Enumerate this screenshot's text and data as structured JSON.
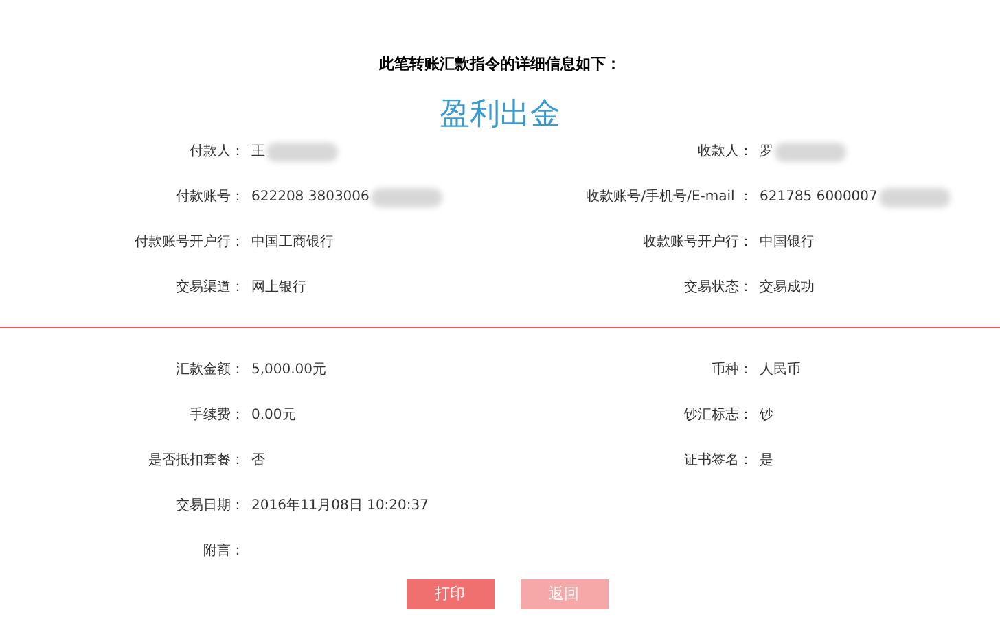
{
  "heading": "此笔转账汇款指令的详细信息如下：",
  "title": "盈利出金",
  "sections": [
    {
      "rows": [
        {
          "left": {
            "label": "付款人：",
            "value": "王",
            "redacted": true
          },
          "right": {
            "label": "收款人：",
            "value": "罗",
            "redacted": true
          }
        },
        {
          "left": {
            "label": "付款账号：",
            "value": "622208 3803006",
            "redacted": true
          },
          "right": {
            "label": "收款账号/手机号/E-mail ：",
            "value": "621785 6000007",
            "redacted": true
          }
        },
        {
          "left": {
            "label": "付款账号开户行：",
            "value": "中国工商银行"
          },
          "right": {
            "label": "收款账号开户行：",
            "value": "中国银行"
          }
        },
        {
          "left": {
            "label": "交易渠道：",
            "value": "网上银行"
          },
          "right": {
            "label": "交易状态：",
            "value": "交易成功"
          }
        }
      ]
    },
    {
      "rows": [
        {
          "left": {
            "label": "汇款金额：",
            "value": "5,000.00元"
          },
          "right": {
            "label": "币种：",
            "value": "人民币"
          }
        },
        {
          "left": {
            "label": "手续费：",
            "value": "0.00元"
          },
          "right": {
            "label": "钞汇标志：",
            "value": "钞"
          }
        },
        {
          "left": {
            "label": "是否抵扣套餐：",
            "value": "否"
          },
          "right": {
            "label": "证书签名：",
            "value": "是"
          }
        },
        {
          "left": {
            "label": "交易日期：",
            "value": "2016年11月08日 10:20:37"
          }
        },
        {
          "left": {
            "label": "附言："
          }
        }
      ]
    }
  ],
  "buttons": [
    {
      "label": "打印",
      "kind": "primary"
    },
    {
      "label": "返回",
      "kind": "secondary"
    }
  ]
}
